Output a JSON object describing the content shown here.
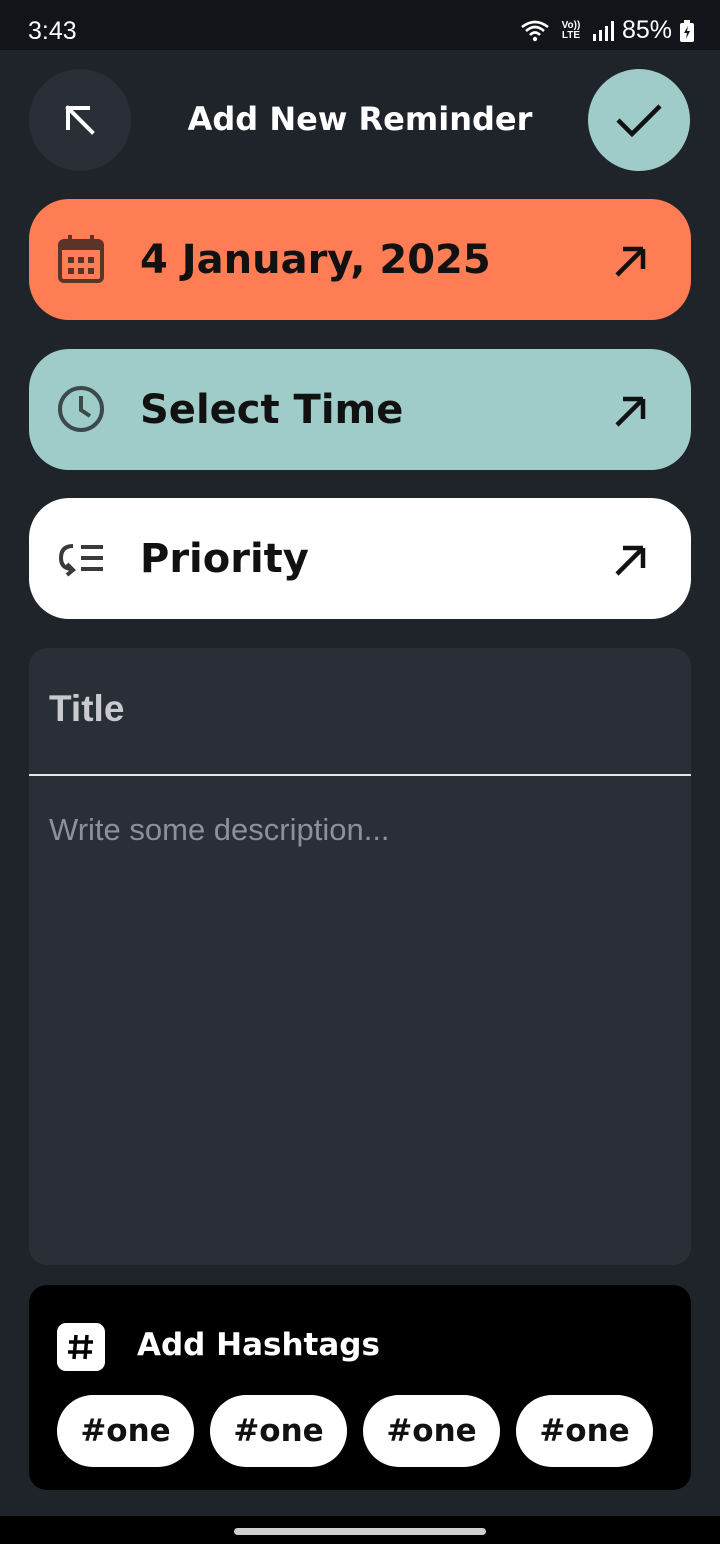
{
  "status_bar": {
    "time": "3:43",
    "network_label": "Vo)) LTE",
    "battery_percent": "85%"
  },
  "header": {
    "title": "Add New Reminder",
    "back_icon": "arrow-up-left-icon",
    "confirm_icon": "check-icon"
  },
  "fields": {
    "date": {
      "label": "4 January, 2025",
      "icon": "calendar-icon",
      "color": "#ff7d54"
    },
    "time": {
      "label": "Select Time",
      "icon": "clock-icon",
      "color": "#9fcbc9"
    },
    "priority": {
      "label": "Priority",
      "icon": "priority-list-icon",
      "color": "#ffffff"
    }
  },
  "note": {
    "title_placeholder": "Title",
    "description_placeholder": "Write some description..."
  },
  "hashtags": {
    "title": "Add Hashtags",
    "tags": [
      "#one",
      "#one",
      "#one",
      "#one"
    ]
  },
  "colors": {
    "background": "#1f232a",
    "card": "#2a2e37",
    "accent_teal": "#9fcbc9",
    "accent_orange": "#ff7d54"
  }
}
